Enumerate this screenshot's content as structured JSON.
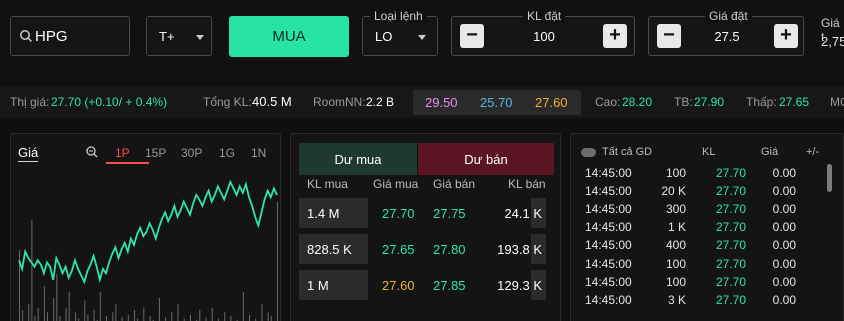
{
  "order": {
    "symbol": "HPG",
    "settlement": "T+",
    "buy_label": "MUA",
    "order_type_label": "Loại lệnh",
    "order_type": "LO",
    "qty_label": "KL đặt",
    "qty": "100",
    "price_label": "Giá đặt",
    "price": "27.5",
    "extra_label": "Giá t",
    "extra_value": "2,75"
  },
  "market": {
    "price_label": "Thị giá:",
    "price_value": "27.70 (+0.10/ + 0.4%)",
    "volume_label": "Tổng KL:",
    "volume_value": "40.5 M",
    "room_label": "RoomNN:",
    "room_value": "2.2 B",
    "ceiling": "29.50",
    "floor": "25.70",
    "reference": "27.60",
    "high_label": "Cao:",
    "high_value": "28.20",
    "avg_label": "TB:",
    "avg_value": "27.90",
    "low_label": "Thấp:",
    "low_value": "27.65",
    "cut_label": "MC"
  },
  "chart": {
    "title": "Giá",
    "timeframes": [
      "1P",
      "15P",
      "30P",
      "1G",
      "1N"
    ],
    "active_timeframe": "1P"
  },
  "chart_data": {
    "type": "line",
    "series_line": [
      30,
      26,
      34,
      31,
      29,
      27,
      30,
      28,
      24,
      29,
      27,
      21,
      31,
      28,
      24,
      27,
      22,
      25,
      30,
      26,
      23,
      20,
      25,
      28,
      32,
      27,
      21,
      26,
      24,
      29,
      33,
      36,
      31,
      35,
      38,
      34,
      40,
      37,
      42,
      45,
      41,
      43,
      47,
      44,
      40,
      45,
      49,
      52,
      48,
      51,
      55,
      50,
      53,
      57,
      54,
      51,
      56,
      60,
      58,
      55,
      59,
      62,
      57,
      60,
      64,
      61,
      58,
      62,
      66,
      63,
      60,
      64,
      61,
      65,
      59,
      55,
      50,
      46,
      52,
      58,
      62,
      59,
      63,
      60
    ],
    "series_volume": [
      60,
      10,
      0,
      15,
      85,
      5,
      12,
      0,
      30,
      8,
      0,
      20,
      40,
      5,
      0,
      12,
      25,
      0,
      8,
      3,
      0,
      18,
      6,
      0,
      10,
      2,
      25,
      0,
      5,
      0,
      8,
      15,
      0,
      4,
      0,
      6,
      0,
      10,
      3,
      0,
      12,
      0,
      5,
      2,
      0,
      20,
      0,
      4,
      0,
      8,
      0,
      15,
      0,
      3,
      0,
      6,
      0,
      2,
      10,
      0,
      4,
      0,
      12,
      0,
      3,
      0,
      8,
      0,
      5,
      0,
      2,
      0,
      25,
      0,
      6,
      0,
      3,
      0,
      15,
      0,
      8,
      5,
      0,
      100
    ]
  },
  "orderbook": {
    "buy_tab": "Dư mua",
    "sell_tab": "Dư bán",
    "headers": [
      "KL mua",
      "Giá mua",
      "Giá bán",
      "KL bán"
    ],
    "rows": [
      {
        "buy_qty": "1.4 M",
        "buy_price": "27.70",
        "sell_price": "27.75",
        "sell_qty": "24.1 K",
        "buy_color": "#2ee6a8",
        "buy_bar": 0.55,
        "sell_bar": 0.12
      },
      {
        "buy_qty": "828.5 K",
        "buy_price": "27.65",
        "sell_price": "27.80",
        "sell_qty": "193.8 K",
        "buy_color": "#2ee6a8",
        "buy_bar": 0.55,
        "sell_bar": 0.12
      },
      {
        "buy_qty": "1 M",
        "buy_price": "27.60",
        "sell_price": "27.85",
        "sell_qty": "129.3 K",
        "buy_color": "#f2b134",
        "buy_bar": 0.55,
        "sell_bar": 0.12
      }
    ]
  },
  "trades": {
    "filter_label": "Tất cả GD",
    "headers": [
      "KL",
      "Giá",
      "+/-"
    ],
    "rows": [
      {
        "time": "14:45:00",
        "qty": "100",
        "price": "27.70",
        "change": "0.00"
      },
      {
        "time": "14:45:00",
        "qty": "20 K",
        "price": "27.70",
        "change": "0.00"
      },
      {
        "time": "14:45:00",
        "qty": "300",
        "price": "27.70",
        "change": "0.00"
      },
      {
        "time": "14:45:00",
        "qty": "1 K",
        "price": "27.70",
        "change": "0.00"
      },
      {
        "time": "14:45:00",
        "qty": "400",
        "price": "27.70",
        "change": "0.00"
      },
      {
        "time": "14:45:00",
        "qty": "100",
        "price": "27.70",
        "change": "0.00"
      },
      {
        "time": "14:45:00",
        "qty": "100",
        "price": "27.70",
        "change": "0.00"
      },
      {
        "time": "14:45:00",
        "qty": "3 K",
        "price": "27.70",
        "change": "0.00"
      }
    ]
  },
  "colors": {
    "accent": "#27e3a6",
    "up": "#2ee6a8",
    "ceiling": "#e98cf2",
    "floor": "#55b5e6",
    "reference": "#f2b134",
    "sell_tab": "#5a1520"
  }
}
